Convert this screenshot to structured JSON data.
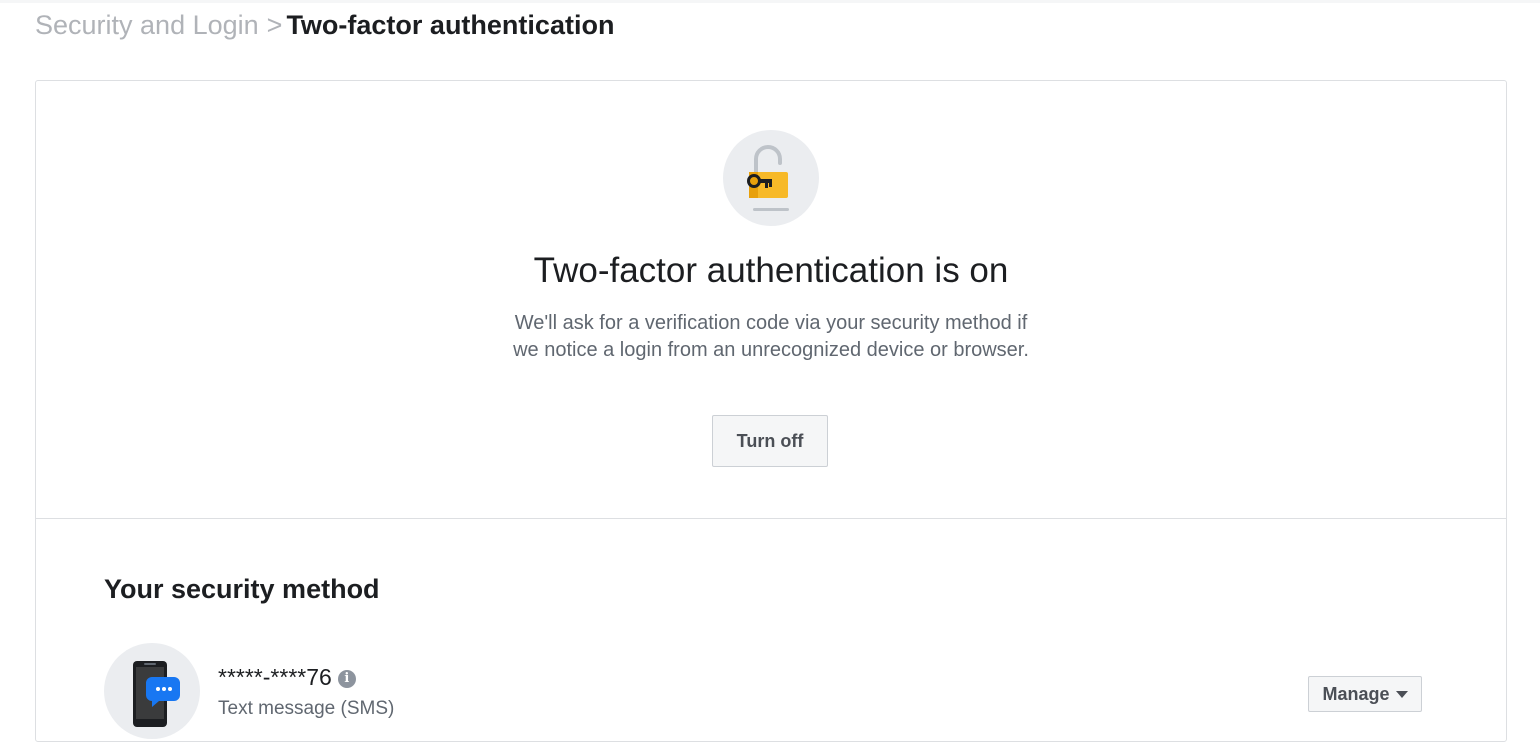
{
  "breadcrumb": {
    "parent": "Security and Login",
    "separator": ">",
    "current": "Two-factor authentication"
  },
  "status": {
    "icon": "unlocked-padlock-key-icon",
    "title": "Two-factor authentication is on",
    "description": "We'll ask for a verification code via your security method if we notice a login from an unrecognized device or browser.",
    "turn_off_label": "Turn off"
  },
  "security_method": {
    "heading": "Your security method",
    "icon": "phone-message-icon",
    "number": "*****-****76",
    "info_icon_glyph": "i",
    "type": "Text message (SMS)",
    "manage_label": "Manage"
  },
  "colors": {
    "key_body": "#f7b928",
    "key_dark": "#1c1e21",
    "message_bubble": "#1877f2",
    "phone_body": "#1c1e21"
  }
}
